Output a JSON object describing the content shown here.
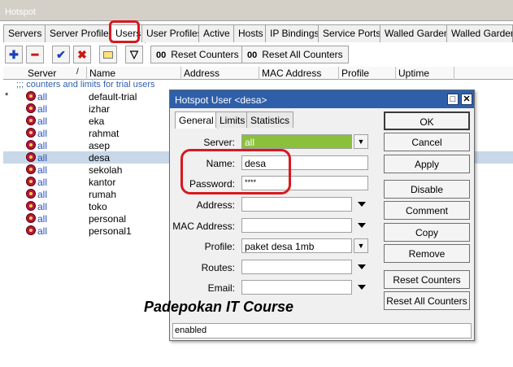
{
  "window": {
    "title": "Hotspot"
  },
  "tabs": [
    "Servers",
    "Server Profiles",
    "Users",
    "User Profiles",
    "Active",
    "Hosts",
    "IP Bindings",
    "Service Ports",
    "Walled Garden",
    "Walled Garden IP"
  ],
  "toolbar": {
    "reset_counters": "Reset Counters",
    "reset_all_counters": "Reset All Counters",
    "counter_prefix": "00"
  },
  "table": {
    "headers": {
      "server": "Server",
      "name": "Name",
      "address": "Address",
      "mac": "MAC Address",
      "profile": "Profile",
      "uptime": "Uptime"
    },
    "comment": ";;; counters and limits for trial users",
    "rows": [
      {
        "mark": "*",
        "server": "all",
        "name": "default-trial"
      },
      {
        "mark": "",
        "server": "all",
        "name": "izhar"
      },
      {
        "mark": "",
        "server": "all",
        "name": "eka"
      },
      {
        "mark": "",
        "server": "all",
        "name": "rahmat"
      },
      {
        "mark": "",
        "server": "all",
        "name": "asep"
      },
      {
        "mark": "",
        "server": "all",
        "name": "desa"
      },
      {
        "mark": "",
        "server": "all",
        "name": "sekolah"
      },
      {
        "mark": "",
        "server": "all",
        "name": "kantor"
      },
      {
        "mark": "",
        "server": "all",
        "name": "rumah"
      },
      {
        "mark": "",
        "server": "all",
        "name": "toko"
      },
      {
        "mark": "",
        "server": "all",
        "name": "personal"
      },
      {
        "mark": "",
        "server": "all",
        "name": "personal1"
      }
    ],
    "selected_index": 5
  },
  "dialog": {
    "title": "Hotspot User <desa>",
    "tabs": [
      "General",
      "Limits",
      "Statistics"
    ],
    "fields": {
      "server_label": "Server:",
      "server_value": "all",
      "name_label": "Name:",
      "name_value": "desa",
      "password_label": "Password:",
      "password_value": "****",
      "address_label": "Address:",
      "mac_label": "MAC Address:",
      "profile_label": "Profile:",
      "profile_value": "paket desa 1mb",
      "routes_label": "Routes:",
      "email_label": "Email:"
    },
    "buttons": [
      "OK",
      "Cancel",
      "Apply",
      "Disable",
      "Comment",
      "Copy",
      "Remove",
      "Reset Counters",
      "Reset All Counters"
    ],
    "status": "enabled"
  },
  "watermark": "Padepokan IT Course",
  "colors": {
    "highlight": "#d71920",
    "title_bar": "#2f5fa8",
    "server_green": "#8ac03c"
  }
}
